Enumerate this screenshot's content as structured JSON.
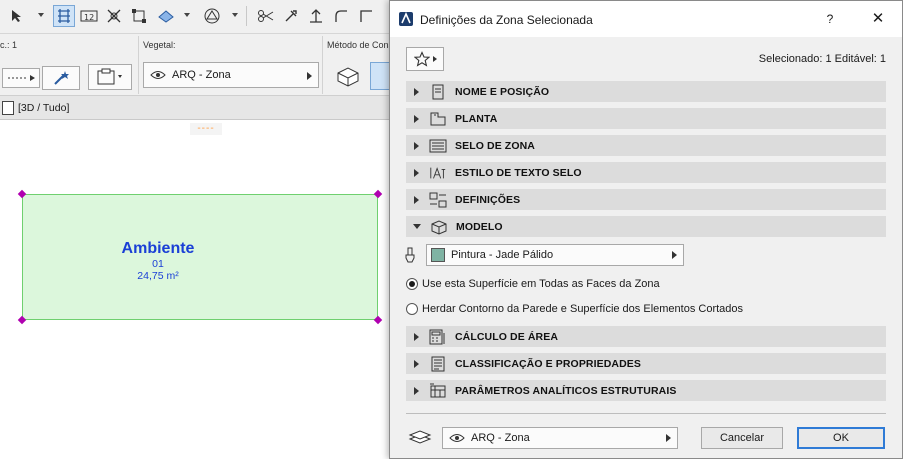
{
  "infobox": {
    "layer_label_partial": "c.: 1",
    "vegetal_label": "Vegetal:",
    "vegetal_layer": "ARQ - Zona",
    "method_label": "Método de Cons"
  },
  "tabs": {
    "view_tab": "[3D / Tudo]"
  },
  "canvas": {
    "dashes": "----",
    "zone_name": "Ambiente",
    "zone_number": "01",
    "zone_area": "24,75 m²",
    "zone_fill_color": "#dcf7dc",
    "zone_border_color": "#6fd06f",
    "handle_color": "#b000b0",
    "stamp_text_color": "#1a3fd6"
  },
  "dialog": {
    "title": "Definições da Zona Selecionada",
    "help": "?",
    "close": "✕",
    "selection_info": "Selecionado: 1 Editável: 1",
    "sections": [
      {
        "label": "NOME E POSIÇÃO",
        "icon": "name-position-icon",
        "open": false
      },
      {
        "label": "PLANTA",
        "icon": "floor-plan-icon",
        "open": false
      },
      {
        "label": "SELO DE ZONA",
        "icon": "zone-stamp-icon",
        "open": false
      },
      {
        "label": "ESTILO DE TEXTO SELO",
        "icon": "text-style-icon",
        "open": false
      },
      {
        "label": "DEFINIÇÕES",
        "icon": "definitions-icon",
        "open": false
      },
      {
        "label": "MODELO",
        "icon": "model-icon",
        "open": true
      },
      {
        "label": "CÁLCULO DE ÁREA",
        "icon": "area-calculation-icon",
        "open": false
      },
      {
        "label": "CLASSIFICAÇÃO E PROPRIEDADES",
        "icon": "classification-icon",
        "open": false
      },
      {
        "label": "PARÂMETROS ANALÍTICOS ESTRUTURAIS",
        "icon": "structural-analytics-icon",
        "open": false
      }
    ],
    "model": {
      "material": "Pintura - Jade Pálido",
      "material_swatch_color": "#7fb3a3",
      "radio_options": [
        {
          "label": "Use esta Superfície em Todas as Faces da Zona",
          "checked": true
        },
        {
          "label": "Herdar Contorno da Parede e  Superfície dos Elementos Cortados",
          "checked": false
        }
      ]
    },
    "footer": {
      "layer": "ARQ - Zona",
      "cancel": "Cancelar",
      "ok": "OK"
    }
  }
}
